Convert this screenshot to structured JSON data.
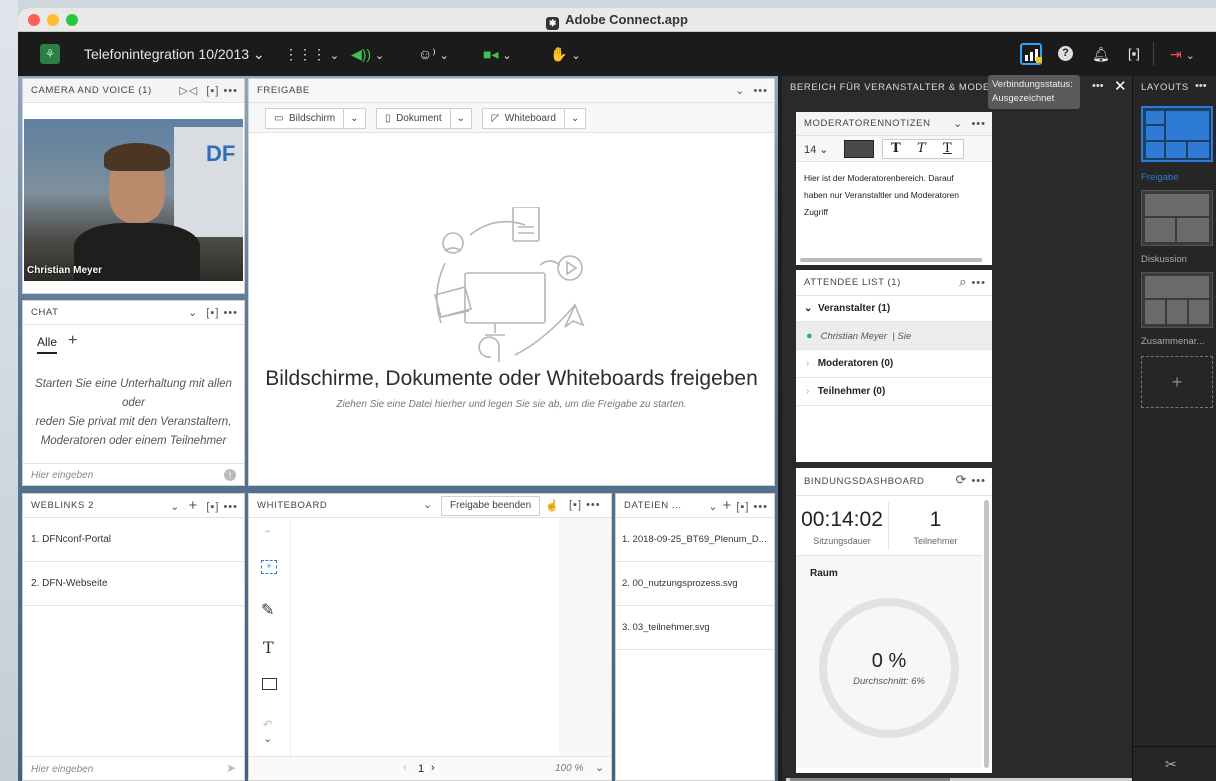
{
  "app": {
    "title": "Adobe Connect.app"
  },
  "toolbar": {
    "meeting_name": "Telefonintegration 10/2013",
    "icons": [
      "apps-grid-icon",
      "speaker-icon",
      "webcam-people-icon",
      "camera-icon",
      "raise-hand-icon",
      "connection-status-icon",
      "help-icon",
      "notification-bell-icon",
      "fullscreen-icon",
      "exit-icon"
    ]
  },
  "tooltip": {
    "line1": "Verbindungsstatus:",
    "line2": "Ausgezeichnet"
  },
  "camera_pod": {
    "title": "CAMERA AND VOICE (1)",
    "person": "Christian Meyer"
  },
  "chat_pod": {
    "title": "CHAT",
    "tab_all": "Alle",
    "empty_line1": "Starten Sie eine Unterhaltung mit allen",
    "empty_line2": "oder",
    "empty_line3": "reden Sie privat mit den Veranstaltern,",
    "empty_line4": "Moderatoren oder einem Teilnehmer",
    "input_placeholder": "Hier eingeben"
  },
  "share_pod": {
    "title": "FREIGABE",
    "btn_screen": "Bildschirm",
    "btn_document": "Dokument",
    "btn_whiteboard": "Whiteboard",
    "headline": "Bildschirme, Dokumente oder Whiteboards freigeben",
    "subline": "Ziehen Sie eine Datei hierher und legen Sie sie ab, um die Freigabe zu starten."
  },
  "weblinks_pod": {
    "title": "WEBLINKS 2",
    "links": [
      "1. DFNconf-Portal",
      "2. DFN-Webseite"
    ],
    "input_placeholder": "Hier eingeben"
  },
  "whiteboard_pod": {
    "title": "WHITEBOARD",
    "stop_button": "Freigabe beenden",
    "page": "1",
    "zoom": "100 %"
  },
  "files_pod": {
    "title": "DATEIEN ...",
    "files": [
      "1. 2018-09-25_BT69_Plenum_D...",
      "2. 00_nutzungsprozess.svg",
      "3. 03_teilnehmer.svg"
    ]
  },
  "host_area": {
    "title": "BEREICH FÜR VERANSTALTER & MODERA",
    "notes": {
      "title": "MODERATORENNOTIZEN",
      "font_size": "14",
      "text_line1": "Hier ist der Moderatorenbereich. Darauf",
      "text_line2": "haben nur Veranstaltler und Moderatoren",
      "text_line3": "Zugriff"
    },
    "attendees": {
      "title": "ATTENDEE LIST  (1)",
      "hosts": "Veranstalter (1)",
      "host_person": "Christian Meyer",
      "host_person_suffix": "| Sie",
      "moderators": "Moderatoren (0)",
      "participants": "Teilnehmer (0)"
    },
    "dashboard": {
      "title": "BINDUNGSDASHBOARD",
      "duration": "00:14:02",
      "duration_label": "Sitzungsdauer",
      "participants": "1",
      "participants_label": "Teilnehmer",
      "room_label": "Raum",
      "room_percent": "0 %",
      "room_average": "Durchschnitt: 6%"
    }
  },
  "layouts": {
    "title": "LAYOUTS",
    "items": [
      "Freigabe",
      "Diskussion",
      "Zusammenar..."
    ],
    "accent": "#2d7bd4"
  }
}
